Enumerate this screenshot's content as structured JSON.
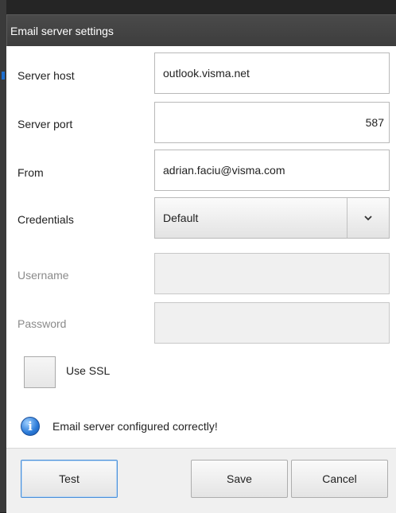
{
  "window": {
    "title": "Email server settings"
  },
  "form": {
    "server_host": {
      "label": "Server host",
      "value": "outlook.visma.net"
    },
    "server_port": {
      "label": "Server port",
      "value": "587"
    },
    "from": {
      "label": "From",
      "value": "adrian.faciu@visma.com"
    },
    "credentials": {
      "label": "Credentials",
      "selected": "Default"
    },
    "username": {
      "label": "Username",
      "value": ""
    },
    "password": {
      "label": "Password",
      "value": ""
    },
    "use_ssl": {
      "label": "Use SSL",
      "checked": false
    }
  },
  "status": {
    "icon": "info-icon",
    "message": "Email server configured correctly!"
  },
  "buttons": {
    "test": "Test",
    "save": "Save",
    "cancel": "Cancel"
  },
  "colors": {
    "titlebar": "#3d3d3d",
    "focus_border": "#4a90d9",
    "info_icon": "#2a7ad8"
  }
}
